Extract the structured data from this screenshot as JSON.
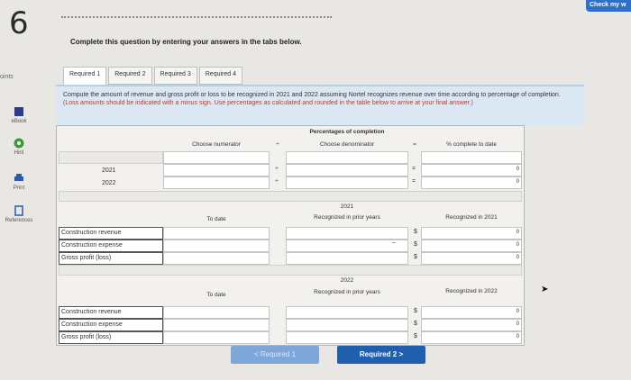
{
  "question_number": "6",
  "points_label": "oints",
  "check_button": "Check my w",
  "instruction": "Complete this question by entering your answers in the tabs below.",
  "sidebar": [
    {
      "label": "eBook",
      "icon": "book-icon"
    },
    {
      "label": "Hint",
      "icon": "hint-icon"
    },
    {
      "label": "Print",
      "icon": "print-icon"
    },
    {
      "label": "References",
      "icon": "references-icon"
    }
  ],
  "tabs": [
    "Required 1",
    "Required 2",
    "Required 3",
    "Required 4"
  ],
  "panel": {
    "text1": "Compute the amount of revenue and gross profit or loss to be recognized in 2021 and 2022 assuming Nortel recognizes revenue over time according to percentage of completion. ",
    "text_red": "(Loss amounts should be indicated with a minus sign. Use percentages as calculated and rounded in the table below to arrive at your final answer.)"
  },
  "pct_table": {
    "title": "Percentages of completion",
    "numerator": "Choose numerator",
    "div": "÷",
    "denominator": "Choose denominator",
    "eq": "=",
    "complete": "% complete to date",
    "years": [
      "2021",
      "2022"
    ],
    "values": [
      "0",
      "0"
    ]
  },
  "section_2021": {
    "year": "2021",
    "to_date": "To date",
    "prior": "Recognized in prior years",
    "recognized": "Recognized in 2021",
    "rows": [
      "Construction revenue",
      "Construction expense",
      "Gross profit (loss)"
    ],
    "dollar": "$",
    "minus": "–",
    "values": [
      "0",
      "0",
      "0"
    ]
  },
  "section_2022": {
    "year": "2022",
    "to_date": "To date",
    "prior": "Recognized in prior years",
    "recognized": "Recognized in 2022",
    "rows": [
      "Construction revenue",
      "Construction expense",
      "Gross profit (loss)"
    ],
    "dollar": "$",
    "values": [
      "0",
      "0",
      "0"
    ]
  },
  "nav": {
    "prev": "< Required 1",
    "next": "Required 2  >"
  }
}
